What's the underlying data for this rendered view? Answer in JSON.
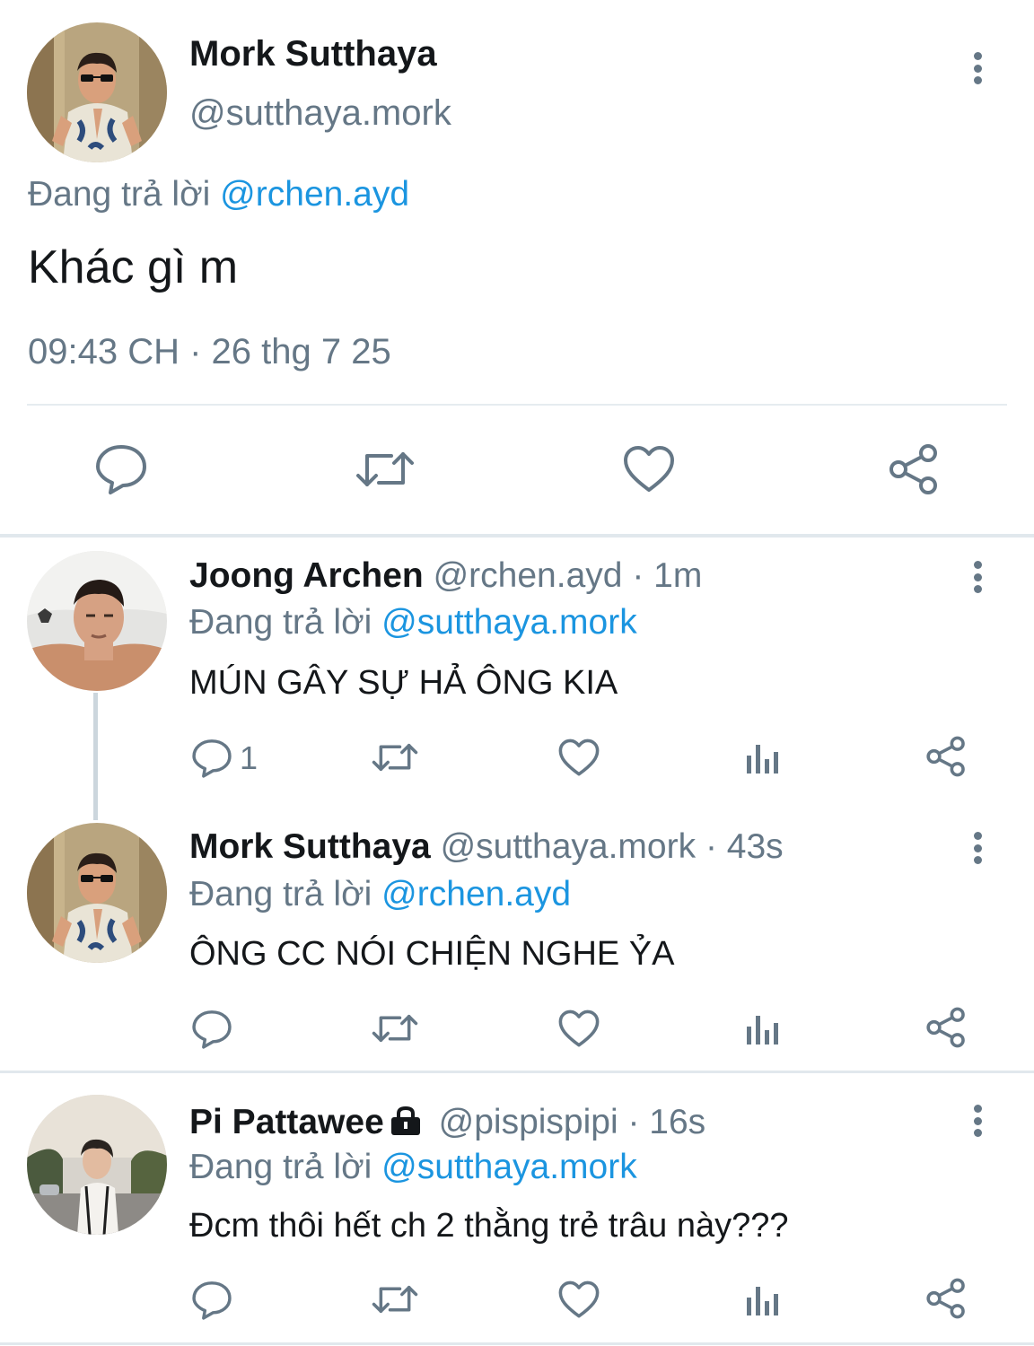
{
  "main_tweet": {
    "name": "Mork Sutthaya",
    "handle": "@sutthaya.mork",
    "replying_prefix": "Đang trả lời",
    "replying_to": "@rchen.ayd",
    "text": "Khác gì m",
    "timestamp": "09:43 CH · 26 thg 7 25",
    "actions": [
      "reply-icon",
      "retweet-icon",
      "heart-icon",
      "share-icon"
    ]
  },
  "replies": [
    {
      "name": "Joong Archen",
      "handle": "@rchen.ayd",
      "time": "· 1m",
      "replying_prefix": "Đang trả lời",
      "replying_to": "@sutthaya.mork",
      "text": "MÚN GÂY SỰ HẢ ÔNG KIA",
      "reply_count": "1"
    },
    {
      "name": "Mork Sutthaya",
      "handle": "@sutthaya.mork",
      "time": "· 43s",
      "replying_prefix": "Đang trả lời",
      "replying_to": "@rchen.ayd",
      "text": "ÔNG CC NÓI CHIỆN NGHE ỶA",
      "reply_count": ""
    },
    {
      "name": "Pi Pattawee",
      "handle": "@pispispipi",
      "time": "· 16s",
      "replying_prefix": "Đang trả lời",
      "replying_to": "@sutthaya.mork",
      "text": "Đcm thôi hết ch 2 thằng trẻ trâu này???",
      "reply_count": "",
      "protected": true
    }
  ],
  "colors": {
    "text": "#14171a",
    "secondary": "#657786",
    "link": "#1b95e0",
    "divider": "#e1e8ed"
  }
}
